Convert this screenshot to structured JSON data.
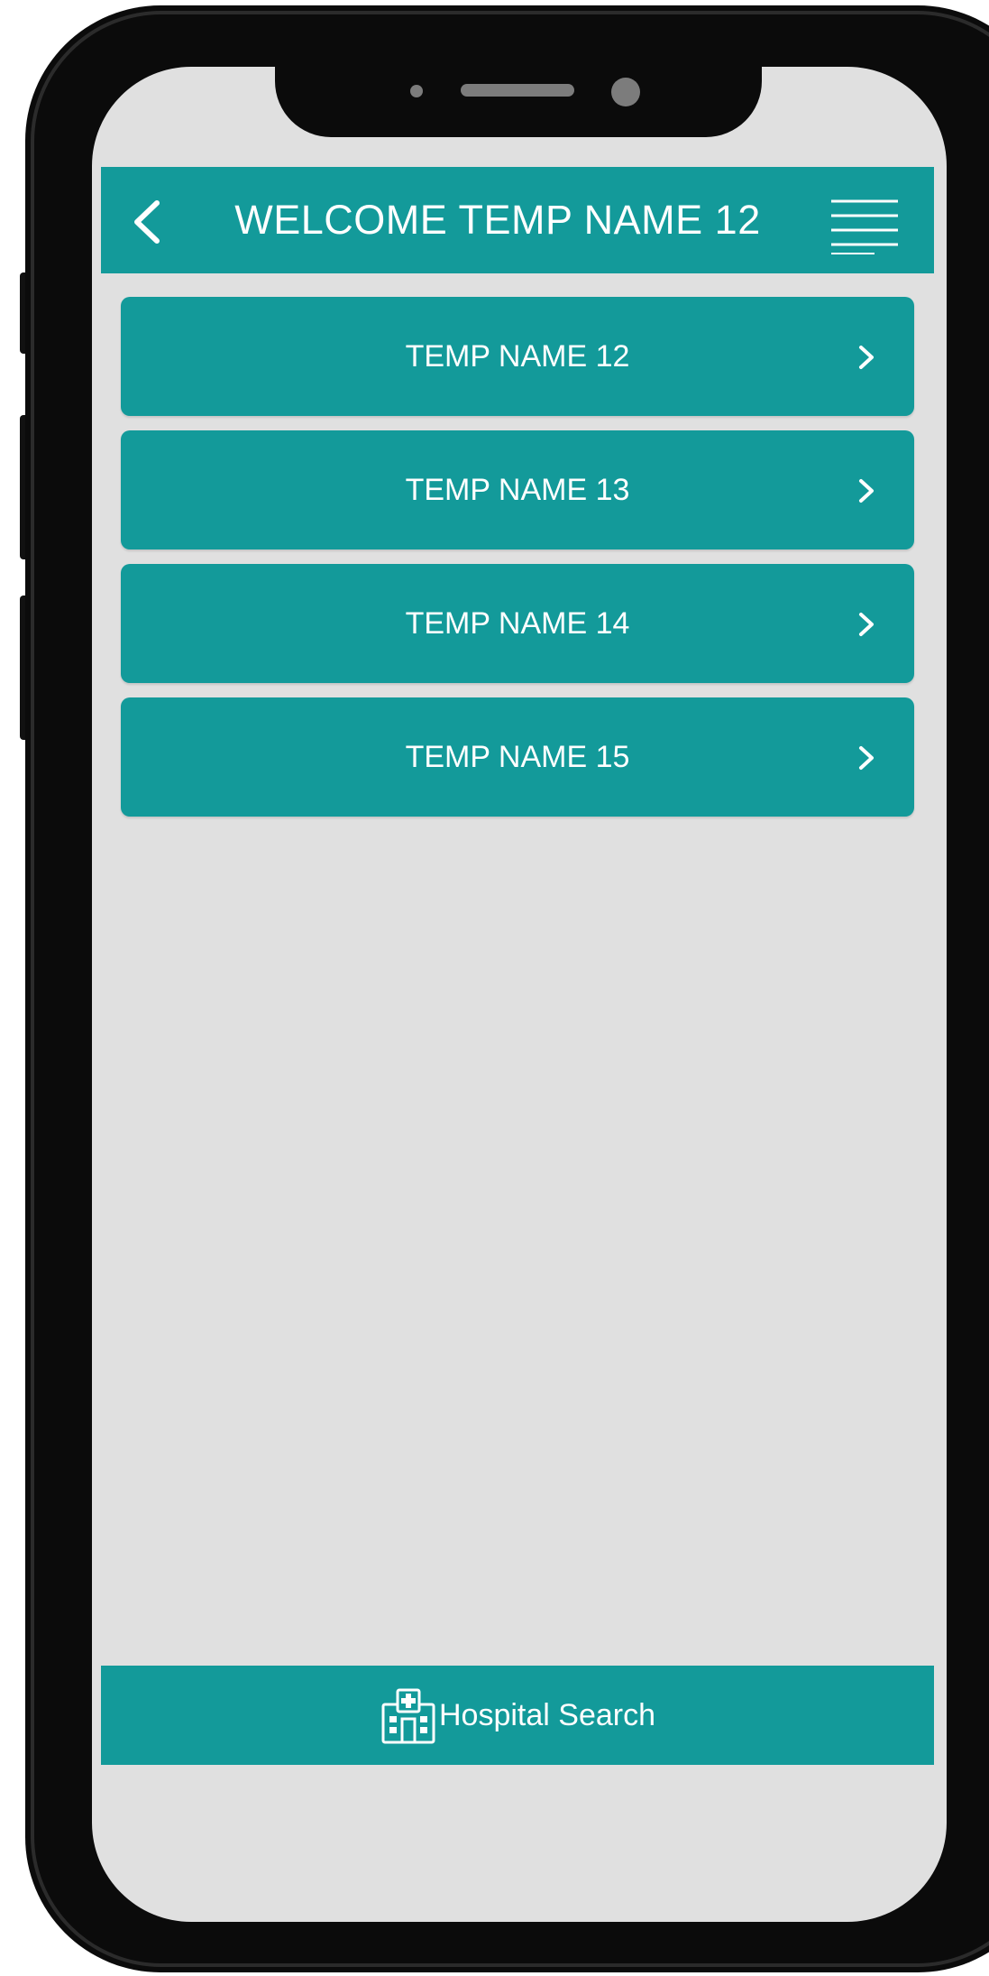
{
  "header": {
    "title": "WELCOME TEMP NAME 12",
    "back_icon": "chevron-left-icon",
    "menu_icon": "hamburger-menu-icon"
  },
  "list": {
    "items": [
      {
        "label": "TEMP NAME 12",
        "icon": "chevron-right-icon"
      },
      {
        "label": "TEMP NAME 13",
        "icon": "chevron-right-icon"
      },
      {
        "label": "TEMP NAME 14",
        "icon": "chevron-right-icon"
      },
      {
        "label": "TEMP NAME 15",
        "icon": "chevron-right-icon"
      }
    ]
  },
  "bottom_bar": {
    "label": "Hospital Search",
    "icon": "hospital-icon"
  },
  "colors": {
    "accent": "#139a9a",
    "screen_background": "#e0e0e0",
    "device_frame": "#0b0b0b",
    "text_on_accent": "#ffffff"
  }
}
